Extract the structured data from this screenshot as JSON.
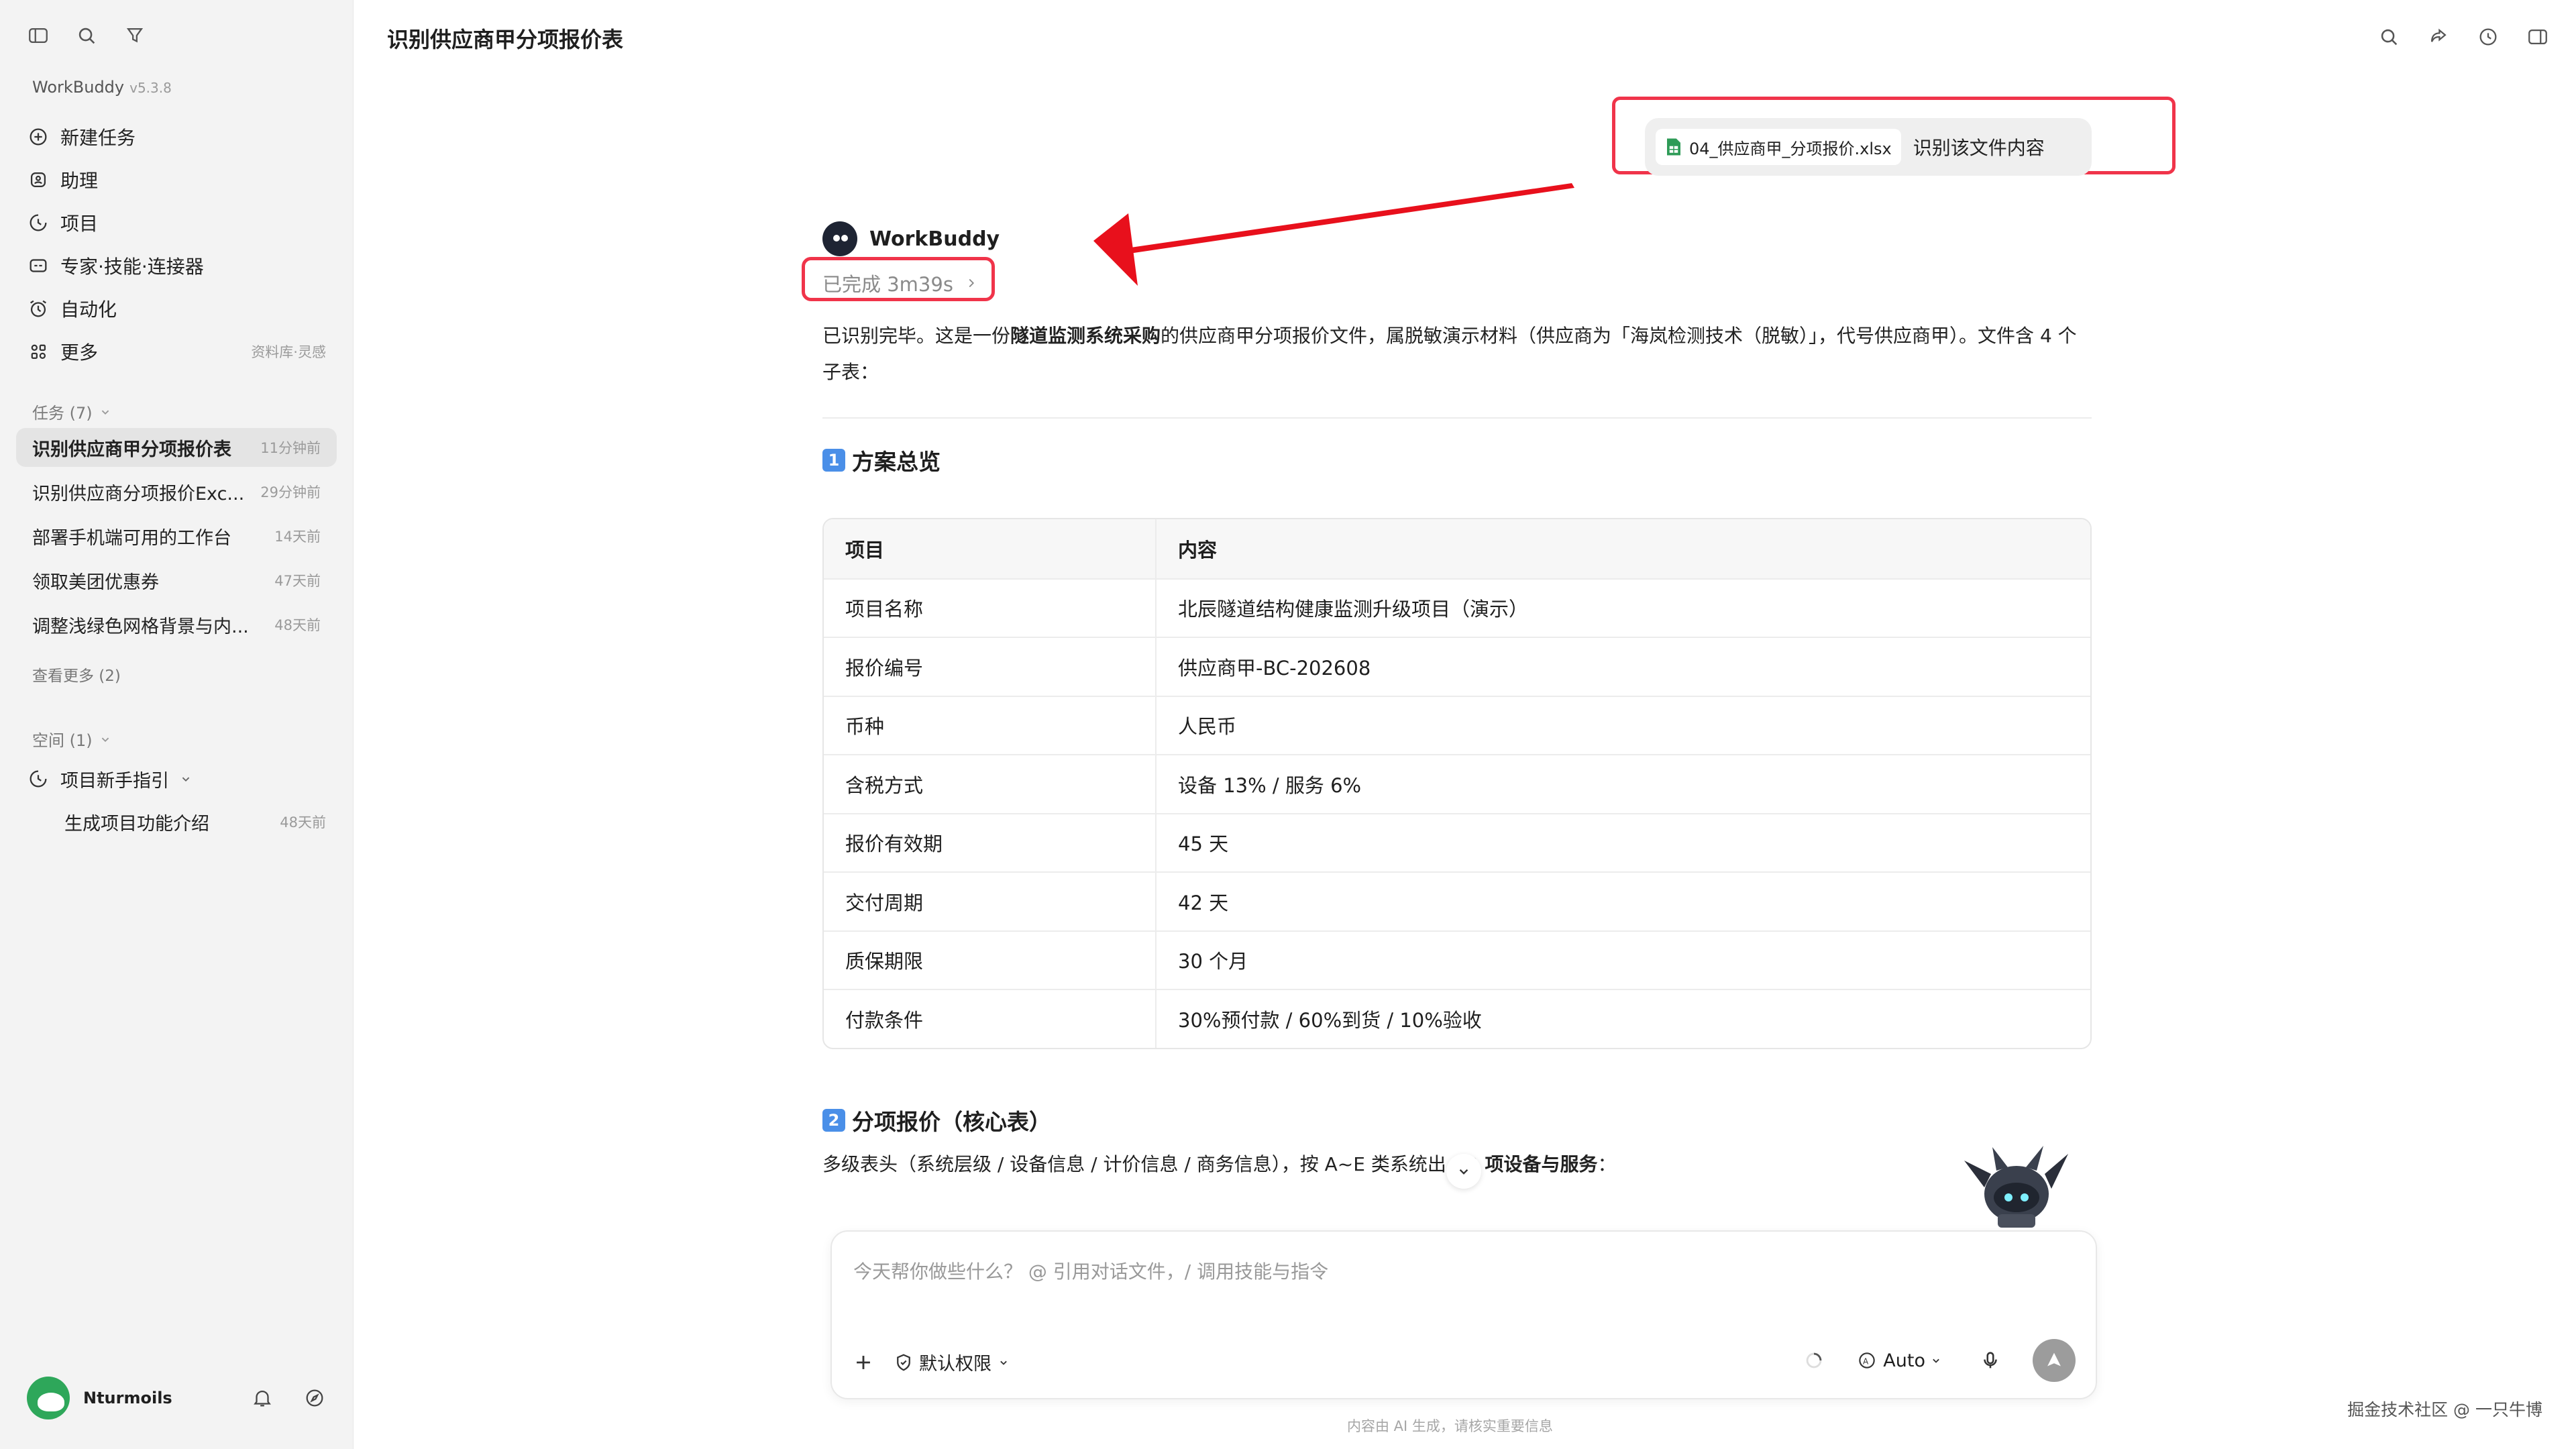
{
  "app": {
    "name": "WorkBuddy",
    "version": "v5.3.8"
  },
  "sidebar": {
    "nav": [
      {
        "label": "新建任务",
        "icon": "plus-circle-icon"
      },
      {
        "label": "助理",
        "icon": "assistant-icon"
      },
      {
        "label": "项目",
        "icon": "project-icon"
      },
      {
        "label": "专家·技能·连接器",
        "icon": "expert-icon"
      },
      {
        "label": "自动化",
        "icon": "alarm-clock-icon"
      },
      {
        "label": "更多",
        "icon": "grid-icon",
        "extra": "资料库·灵感"
      }
    ],
    "tasks_header": "任务 (7)",
    "tasks": [
      {
        "title": "识别供应商甲分项报价表",
        "time": "11分钟前",
        "active": true
      },
      {
        "title": "识别供应商分项报价Exc...",
        "time": "29分钟前"
      },
      {
        "title": "部署手机端可用的工作台",
        "time": "14天前"
      },
      {
        "title": "领取美团优惠券",
        "time": "47天前"
      },
      {
        "title": "调整浅绿色网格背景与内...",
        "time": "48天前"
      }
    ],
    "see_more": "查看更多 (2)",
    "space_header": "空间 (1)",
    "space_project": "项目新手指引",
    "space_item": {
      "title": "生成项目功能介绍",
      "time": "48天前"
    },
    "user": "Nturmoils"
  },
  "header": {
    "title": "识别供应商甲分项报价表"
  },
  "user_message": {
    "file_name": "04_供应商甲_分项报价.xlsx",
    "text": "识别该文件内容"
  },
  "assistant": {
    "name": "WorkBuddy",
    "status": "已完成 3m39s",
    "intro_1": "已识别完毕。这是一份",
    "intro_bold": "隧道监测系统采购",
    "intro_2": "的供应商甲分项报价文件，属脱敏演示材料（供应商为「海岚检测技术（脱敏）」，代号供应商甲）。文件含 4 个子表：",
    "section1_num": "1",
    "section1_title": "方案总览",
    "table": {
      "headers": [
        "项目",
        "内容"
      ],
      "rows": [
        [
          "项目名称",
          "北辰隧道结构健康监测升级项目（演示）"
        ],
        [
          "报价编号",
          "供应商甲-BC-202608"
        ],
        [
          "币种",
          "人民币"
        ],
        [
          "含税方式",
          "设备 13% / 服务 6%"
        ],
        [
          "报价有效期",
          "45 天"
        ],
        [
          "交付周期",
          "42 天"
        ],
        [
          "质保期限",
          "30 个月"
        ],
        [
          "付款条件",
          "30%预付款 / 60%到货 / 10%验收"
        ]
      ]
    },
    "section2_num": "2",
    "section2_title": "分项报价（核心表）",
    "section2_intro_1": "多级表头（系统层级 / 设备信息 / 计价信息 / 商务信息），按 A~E 类系统",
    "section2_intro_2": "出 ",
    "section2_intro_bold": "12 项设备与服务",
    "section2_intro_3": "："
  },
  "composer": {
    "placeholder": "今天帮你做些什么？ @ 引用对话文件，/ 调用技能与指令",
    "permission": "默认权限",
    "model": "Auto"
  },
  "footer_note": "内容由 AI 生成，请核实重要信息",
  "watermark": "掘金技术社区 @ 一只牛博",
  "colors": {
    "highlight": "#f0344a",
    "arrow": "#e8101c",
    "accent": "#4a8fe8"
  }
}
